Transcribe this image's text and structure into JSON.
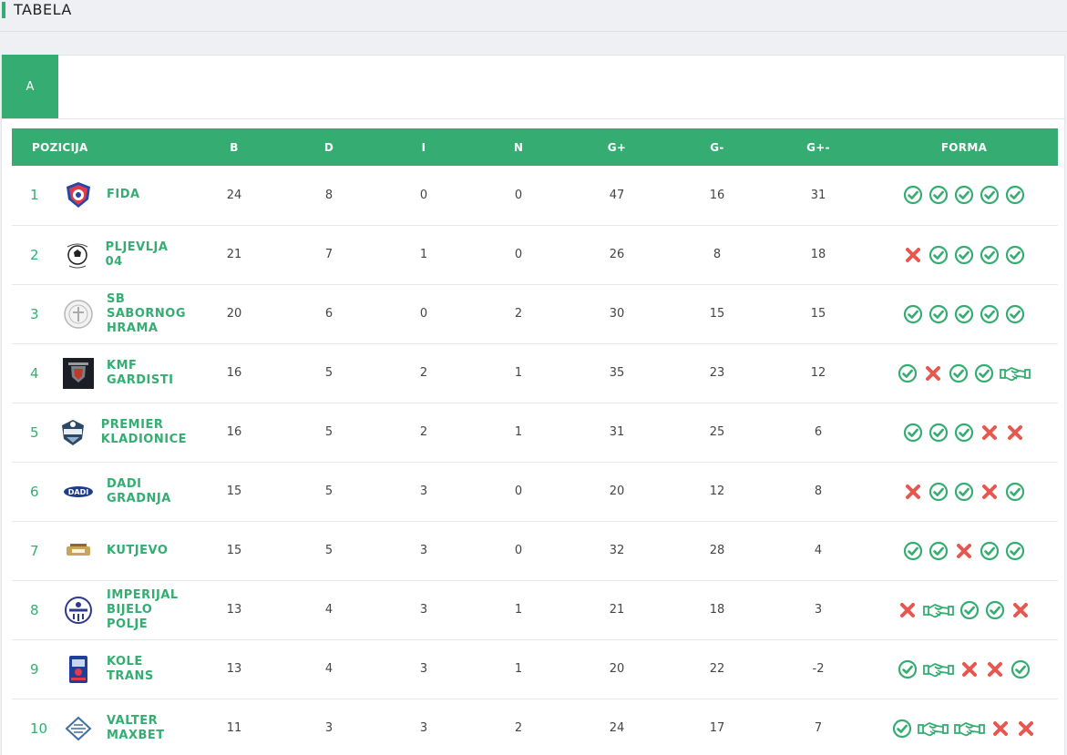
{
  "page": {
    "title": "TABELA"
  },
  "tabs": [
    {
      "label": "A"
    }
  ],
  "columns": [
    "POZICIJA",
    "B",
    "D",
    "I",
    "N",
    "G+",
    "G-",
    "G+-",
    "FORMA"
  ],
  "colors": {
    "accent": "#35ad72",
    "loss": "#e8574f",
    "win": "#35ad72"
  },
  "rows": [
    {
      "rank": "1",
      "team": "FIDA",
      "logo": "fida-logo",
      "b": "24",
      "d": "8",
      "i": "0",
      "n": "0",
      "gp": "47",
      "gm": "16",
      "gd": "31",
      "form": [
        "W",
        "W",
        "W",
        "W",
        "W"
      ]
    },
    {
      "rank": "2",
      "team": "PLJEVLJA 04",
      "logo": "pljevlja-logo",
      "b": "21",
      "d": "7",
      "i": "1",
      "n": "0",
      "gp": "26",
      "gm": "8",
      "gd": "18",
      "form": [
        "L",
        "W",
        "W",
        "W",
        "W"
      ]
    },
    {
      "rank": "3",
      "team": "SB\nSABORNOG\nHRAMA",
      "logo": "sb-sabornog-hrama-logo",
      "b": "20",
      "d": "6",
      "i": "0",
      "n": "2",
      "gp": "30",
      "gm": "15",
      "gd": "15",
      "form": [
        "W",
        "W",
        "W",
        "W",
        "W"
      ]
    },
    {
      "rank": "4",
      "team": "KMF\nGARDISTI",
      "logo": "kmf-gardisti-logo",
      "b": "16",
      "d": "5",
      "i": "2",
      "n": "1",
      "gp": "35",
      "gm": "23",
      "gd": "12",
      "form": [
        "W",
        "L",
        "W",
        "W",
        "D"
      ]
    },
    {
      "rank": "5",
      "team": "PREMIER\nKLADIONICE",
      "logo": "premier-kladionice-logo",
      "b": "16",
      "d": "5",
      "i": "2",
      "n": "1",
      "gp": "31",
      "gm": "25",
      "gd": "6",
      "form": [
        "W",
        "W",
        "W",
        "L",
        "L"
      ]
    },
    {
      "rank": "6",
      "team": "DADI\nGRADNJA",
      "logo": "dadi-gradnja-logo",
      "b": "15",
      "d": "5",
      "i": "3",
      "n": "0",
      "gp": "20",
      "gm": "12",
      "gd": "8",
      "form": [
        "L",
        "W",
        "W",
        "L",
        "W"
      ]
    },
    {
      "rank": "7",
      "team": "KUTJEVO",
      "logo": "kutjevo-logo",
      "b": "15",
      "d": "5",
      "i": "3",
      "n": "0",
      "gp": "32",
      "gm": "28",
      "gd": "4",
      "form": [
        "W",
        "W",
        "L",
        "W",
        "W"
      ]
    },
    {
      "rank": "8",
      "team": "IMPERIJAL\nBIJELO\nPOLJE",
      "logo": "imperijal-logo",
      "b": "13",
      "d": "4",
      "i": "3",
      "n": "1",
      "gp": "21",
      "gm": "18",
      "gd": "3",
      "form": [
        "L",
        "D",
        "W",
        "W",
        "L"
      ]
    },
    {
      "rank": "9",
      "team": "KOLE\nTRANS",
      "logo": "kole-trans-logo",
      "b": "13",
      "d": "4",
      "i": "3",
      "n": "1",
      "gp": "20",
      "gm": "22",
      "gd": "-2",
      "form": [
        "W",
        "D",
        "L",
        "L",
        "W"
      ]
    },
    {
      "rank": "10",
      "team": "VALTER\nMAXBET",
      "logo": "valter-maxbet-logo",
      "b": "11",
      "d": "3",
      "i": "3",
      "n": "2",
      "gp": "24",
      "gm": "17",
      "gd": "7",
      "form": [
        "W",
        "D",
        "D",
        "L",
        "L"
      ]
    }
  ]
}
